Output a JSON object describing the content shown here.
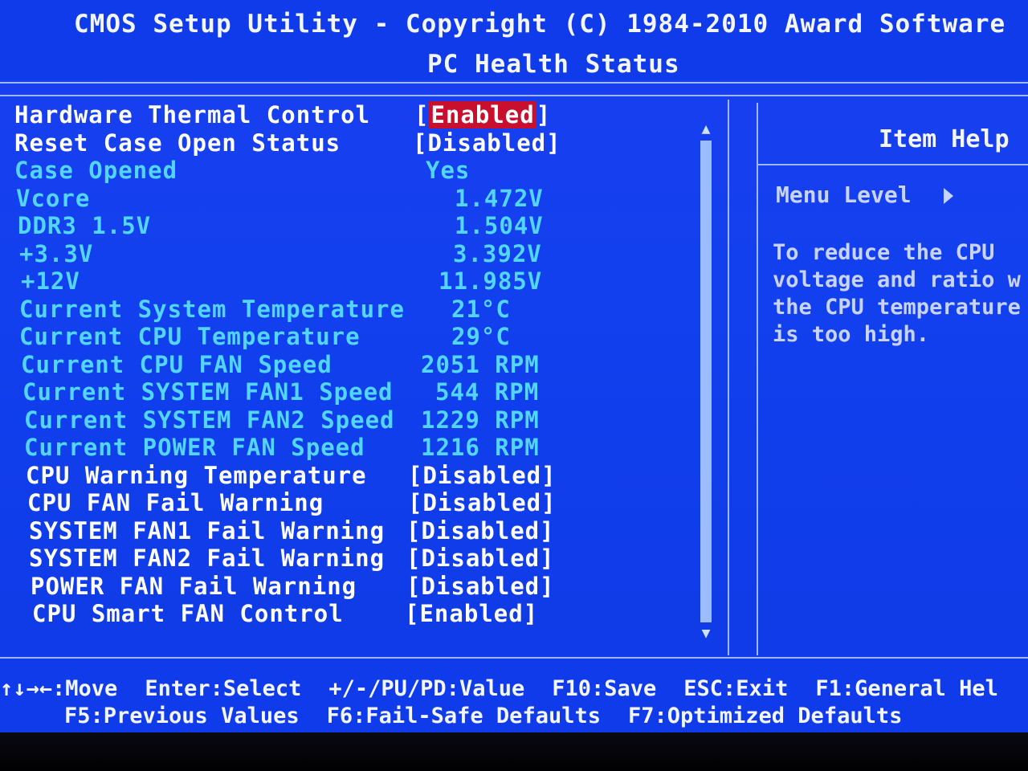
{
  "header": {
    "title": "CMOS Setup Utility - Copyright (C) 1984-2010 Award Software",
    "subtitle": "PC Health Status"
  },
  "settings": [
    {
      "label": "Hardware Thermal Control",
      "value": "Enabled",
      "type": "option",
      "selected": true
    },
    {
      "label": "Reset Case Open Status",
      "value": "Disabled",
      "type": "option"
    },
    {
      "label": "Case Opened",
      "value": "Yes",
      "type": "readonly"
    },
    {
      "label": "Vcore",
      "value": "1.472V",
      "type": "readonly"
    },
    {
      "label": "DDR3 1.5V",
      "value": "1.504V",
      "type": "readonly"
    },
    {
      "label": "+3.3V",
      "value": "3.392V",
      "type": "readonly"
    },
    {
      "label": "+12V",
      "value": "11.985V",
      "type": "readonly"
    },
    {
      "label": "Current System Temperature",
      "value": "21°C",
      "type": "readonly"
    },
    {
      "label": "Current CPU Temperature",
      "value": "29°C",
      "type": "readonly"
    },
    {
      "label": "Current CPU FAN Speed",
      "value": "2051 RPM",
      "type": "readonly"
    },
    {
      "label": "Current SYSTEM FAN1 Speed",
      "value": "544 RPM",
      "type": "readonly"
    },
    {
      "label": "Current SYSTEM FAN2 Speed",
      "value": "1229 RPM",
      "type": "readonly"
    },
    {
      "label": "Current POWER FAN Speed",
      "value": "1216 RPM",
      "type": "readonly"
    },
    {
      "label": "CPU Warning Temperature",
      "value": "Disabled",
      "type": "option"
    },
    {
      "label": "CPU FAN Fail Warning",
      "value": "Disabled",
      "type": "option"
    },
    {
      "label": "SYSTEM FAN1 Fail Warning",
      "value": "Disabled",
      "type": "option"
    },
    {
      "label": "SYSTEM FAN2 Fail Warning",
      "value": "Disabled",
      "type": "option"
    },
    {
      "label": "POWER FAN Fail Warning",
      "value": "Disabled",
      "type": "option"
    },
    {
      "label": "CPU Smart FAN Control",
      "value": "Enabled",
      "type": "option"
    }
  ],
  "help": {
    "title": "Item Help",
    "menu_level": "Menu Level",
    "lines": [
      "To reduce the CPU",
      "voltage and ratio w",
      "the CPU temperature",
      "is too high."
    ]
  },
  "footer": {
    "row1": [
      "↑↓→←:Move",
      "Enter:Select",
      "+/-/PU/PD:Value",
      "F10:Save",
      "ESC:Exit",
      "F1:General Hel"
    ],
    "row2": [
      "F5:Previous Values",
      "F6:Fail-Safe Defaults",
      "F7:Optimized Defaults"
    ]
  },
  "icons": {
    "scroll_up": "▲",
    "scroll_down": "▼"
  },
  "colors": {
    "background": "#1240ee",
    "readonly_text": "#52d6ff",
    "selected_highlight": "#c8102e"
  }
}
